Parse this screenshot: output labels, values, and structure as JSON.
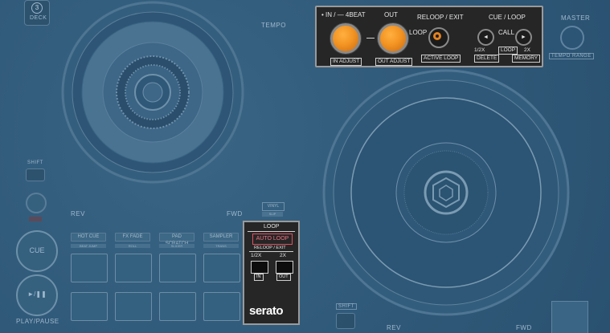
{
  "deck_controls": {
    "deck_number": "3",
    "deck_label": "DECK",
    "tempo_label": "TEMPO",
    "master_label": "MASTER",
    "tempo_range_label": "TEMPO RANGE",
    "shift_label": "SHIFT",
    "rev_label_left": "REV",
    "fwd_label_left": "FWD",
    "rev_label_right": "REV",
    "fwd_label_right": "FWD",
    "cue_label": "CUE",
    "play_pause_label": "PLAY/PAUSE",
    "play_pause_icon": "►/❚❚",
    "vinyl_label": "VINYL",
    "slip_label": "SLIP"
  },
  "performance_pads": {
    "modes": [
      {
        "label": "HOT CUE",
        "sub": "BEAT JUMP"
      },
      {
        "label": "FX FADE",
        "sub": "ROLL"
      },
      {
        "label": "PAD SCRATCH",
        "sub": "SLICER"
      },
      {
        "label": "SAMPLER",
        "sub": "TRANS"
      }
    ]
  },
  "top_loop_panel": {
    "in_label": "• IN / — 4BEAT",
    "out_label": "OUT",
    "reloop_label": "RELOOP / EXIT",
    "cue_loop_label": "CUE / LOOP",
    "loop_label": "LOOP",
    "call_label": "CALL",
    "in_adjust": "IN ADJUST",
    "out_adjust": "OUT ADJUST",
    "active_loop": "ACTIVE LOOP",
    "delete_label": "DELETE",
    "memory_label": "MEMORY",
    "half_label": "1/2X",
    "loop_small": "LOOP",
    "double_label": "2X",
    "left_arrow": "◄",
    "right_arrow": "►"
  },
  "left_loop_panel": {
    "title": "LOOP",
    "auto_loop": "AUTO LOOP",
    "reloop_exit": "RELOOP / EXIT",
    "half": "1/2X",
    "double": "2X",
    "in": "IN",
    "out": "OUT",
    "brand": "serato"
  }
}
